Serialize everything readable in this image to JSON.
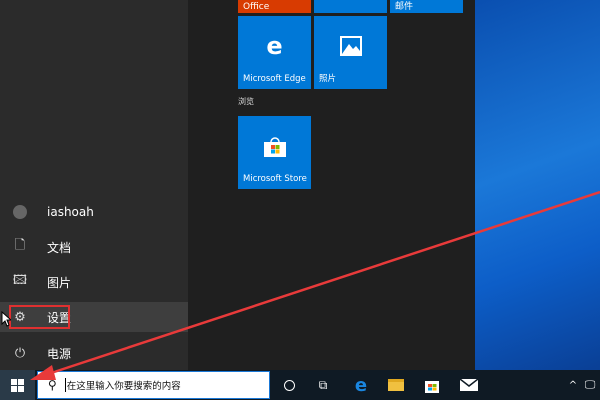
{
  "start_menu": {
    "user": "iashoah",
    "items": [
      {
        "label": "文档",
        "icon": "document-icon"
      },
      {
        "label": "图片",
        "icon": "pictures-icon"
      },
      {
        "label": "设置",
        "icon": "gear-icon",
        "selected": true
      },
      {
        "label": "电源",
        "icon": "power-icon"
      }
    ],
    "tiles": [
      {
        "label": "Office",
        "color": "#d83b01"
      },
      {
        "label": "",
        "color": "#0078d7"
      },
      {
        "label": "邮件",
        "color": "#0078d7"
      },
      {
        "label": "Microsoft Edge",
        "color": "#0078d7"
      },
      {
        "label": "照片",
        "color": "#0078d7"
      },
      {
        "label": "Microsoft Store",
        "color": "#0078d7"
      }
    ],
    "section_label": "浏览"
  },
  "taskbar": {
    "search_placeholder": "在这里输入你要搜索的内容"
  },
  "annotation": {
    "color": "#e83a3a"
  }
}
